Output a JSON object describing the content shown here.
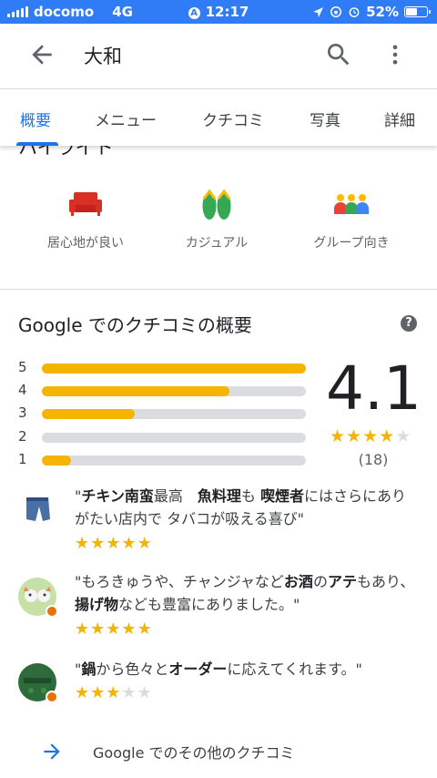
{
  "status_bar": {
    "carrier": "docomo",
    "network": "4G",
    "time": "12:17",
    "battery": "52%"
  },
  "header": {
    "title": "大和"
  },
  "tabs": [
    {
      "label": "概要",
      "active": true
    },
    {
      "label": "メニュー",
      "active": false
    },
    {
      "label": "クチコミ",
      "active": false
    },
    {
      "label": "写真",
      "active": false
    },
    {
      "label": "詳細",
      "active": false
    }
  ],
  "highlights": {
    "heading": "ハイライト",
    "items": [
      {
        "label": "居心地が良い",
        "icon": "sofa-icon"
      },
      {
        "label": "カジュアル",
        "icon": "sandals-icon"
      },
      {
        "label": "グループ向き",
        "icon": "group-icon"
      }
    ]
  },
  "review_summary": {
    "title": "Google でのクチコミの概要",
    "rating": "4.1",
    "rating_stars": 4,
    "review_count": "(18)",
    "distribution": [
      {
        "stars": "5",
        "fraction": 1.0
      },
      {
        "stars": "4",
        "fraction": 0.71
      },
      {
        "stars": "3",
        "fraction": 0.35
      },
      {
        "stars": "2",
        "fraction": 0.0
      },
      {
        "stars": "1",
        "fraction": 0.11
      }
    ]
  },
  "snippets": [
    {
      "parts": [
        "\"",
        "チキン南蛮",
        "最高　",
        "魚料理",
        "も ",
        "喫煙者",
        "にはさらにありがたい店内で タバコが吸える喜び\""
      ],
      "rating": 5
    },
    {
      "parts": [
        "\"もろきゅうや、チャンジャなど",
        "お酒",
        "の",
        "アテ",
        "もあり、",
        "揚げ物",
        "なども豊富にありました。\""
      ],
      "rating": 5
    },
    {
      "parts": [
        "\"",
        "鍋",
        "から色々と",
        "オーダー",
        "に応えてくれます。\""
      ],
      "rating": 3
    }
  ],
  "more_reviews_label": "Google でのその他のクチコミ",
  "colors": {
    "status_bar": "#2f7cf6",
    "accent": "#1a73e8",
    "star": "#f4b400"
  }
}
